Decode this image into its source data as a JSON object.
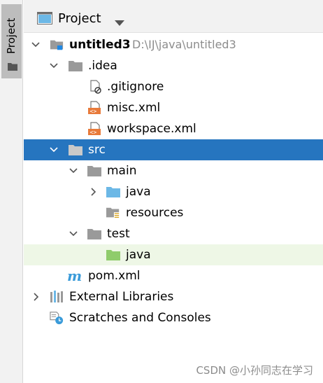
{
  "sidebar": {
    "tab_label": "Project"
  },
  "header": {
    "title": "Project",
    "icon": "project-window-icon",
    "dropdown_icon": "chevron-down-icon"
  },
  "tree": {
    "project": {
      "name": "untitled3",
      "path": "D:\\IJ\\java\\untitled3"
    },
    "idea": {
      "label": ".idea"
    },
    "gitignore": {
      "label": ".gitignore"
    },
    "misc": {
      "label": "misc.xml"
    },
    "workspace": {
      "label": "workspace.xml"
    },
    "src": {
      "label": "src"
    },
    "main": {
      "label": "main"
    },
    "main_java": {
      "label": "java"
    },
    "resources": {
      "label": "resources"
    },
    "test": {
      "label": "test"
    },
    "test_java": {
      "label": "java"
    },
    "pom": {
      "label": "pom.xml"
    },
    "external_libraries": {
      "label": "External Libraries"
    },
    "scratches": {
      "label": "Scratches and Consoles"
    }
  },
  "colors": {
    "selection": "#2675bf",
    "test_row_highlight": "#eef7e6",
    "folder_grey": "#9a9a9a",
    "folder_source_blue": "#6cb8e6",
    "folder_test_green": "#8fcc6b",
    "xml_orange": "#e87a3a"
  },
  "watermark": "CSDN @小孙同志在学习"
}
